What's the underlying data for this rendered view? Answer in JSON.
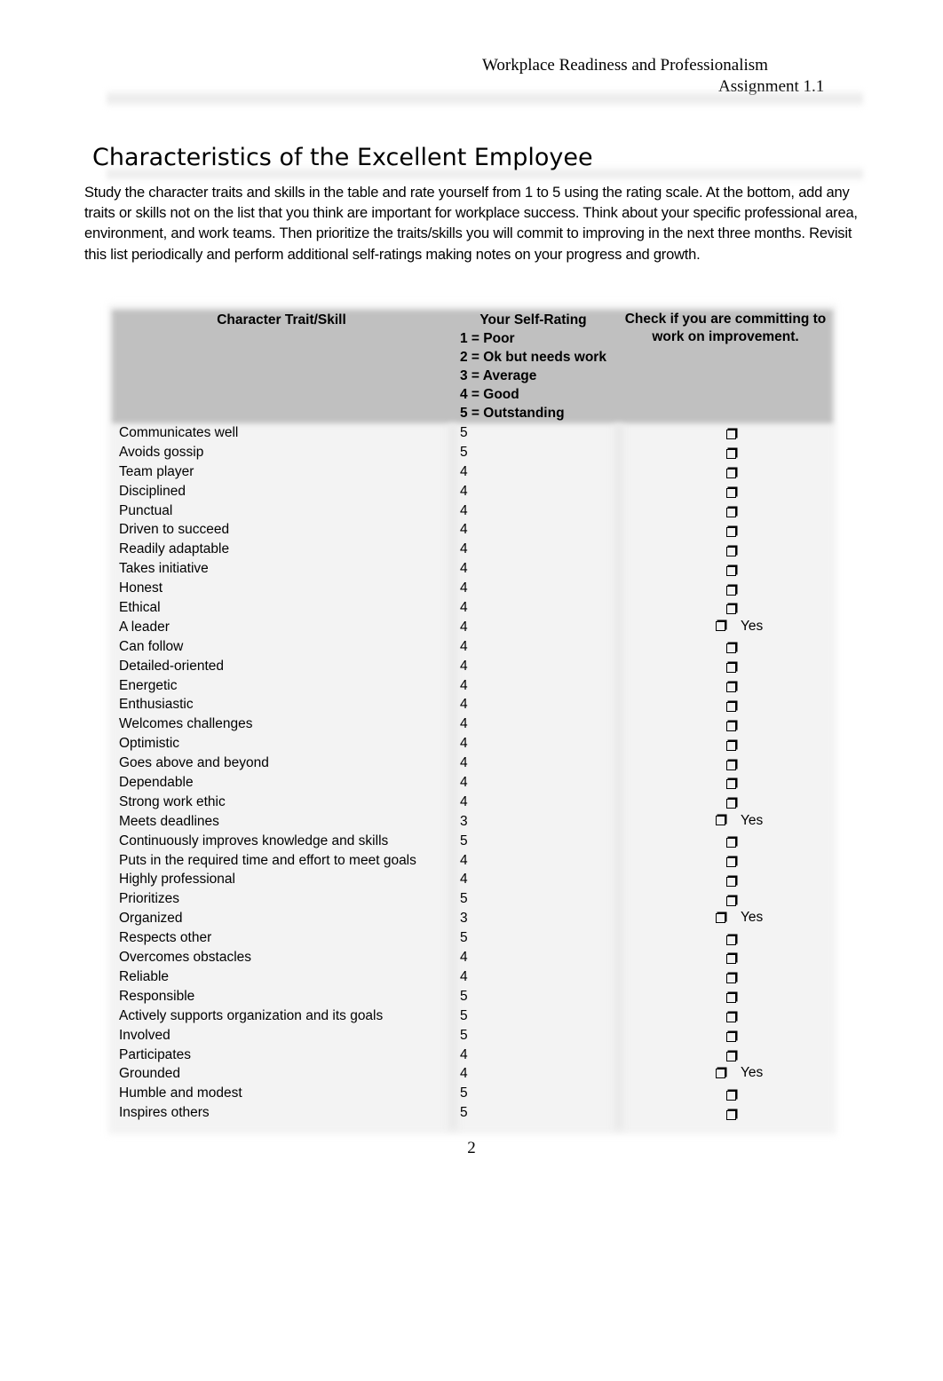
{
  "header": {
    "course": "Workplace Readiness and Professionalism",
    "assignment": "Assignment 1.1"
  },
  "title": "Characteristics of the Excellent Employee",
  "intro": "Study the character traits and skills in the table and rate yourself from 1 to 5 using the rating scale. At the bottom, add any traits or skills not on the list that you think are important for workplace success. Think about your specific professional area, environment, and work teams. Then prioritize the traits/skills you will commit to improving in the next three months. Revisit this list periodically and perform additional self-ratings making notes on your progress and growth.",
  "table": {
    "headers": {
      "trait": "Character Trait/Skill",
      "rating_title": "Your Self-Rating",
      "rating_scale": [
        "1 = Poor",
        "2 = Ok but needs work",
        "3 = Average",
        "4 = Good",
        "5 = Outstanding"
      ],
      "commit": "Check if you are committing to work on improvement."
    },
    "checkbox_icon": "shadowed-box",
    "rows": [
      {
        "trait": "Communicates well",
        "rating": "5",
        "commit": ""
      },
      {
        "trait": "Avoids gossip",
        "rating": "5",
        "commit": ""
      },
      {
        "trait": "Team player",
        "rating": "4",
        "commit": ""
      },
      {
        "trait": "Disciplined",
        "rating": "4",
        "commit": ""
      },
      {
        "trait": "Punctual",
        "rating": "4",
        "commit": ""
      },
      {
        "trait": "Driven to succeed",
        "rating": "4",
        "commit": ""
      },
      {
        "trait": "Readily adaptable",
        "rating": "4",
        "commit": ""
      },
      {
        "trait": "Takes initiative",
        "rating": "4",
        "commit": ""
      },
      {
        "trait": "Honest",
        "rating": "4",
        "commit": ""
      },
      {
        "trait": "Ethical",
        "rating": "4",
        "commit": ""
      },
      {
        "trait": "A leader",
        "rating": "4",
        "commit": "Yes"
      },
      {
        "trait": "Can follow",
        "rating": "4",
        "commit": ""
      },
      {
        "trait": "Detailed-oriented",
        "rating": "4",
        "commit": ""
      },
      {
        "trait": "Energetic",
        "rating": "4",
        "commit": ""
      },
      {
        "trait": "Enthusiastic",
        "rating": "4",
        "commit": ""
      },
      {
        "trait": "Welcomes challenges",
        "rating": "4",
        "commit": ""
      },
      {
        "trait": "Optimistic",
        "rating": "4",
        "commit": ""
      },
      {
        "trait": "Goes above and beyond",
        "rating": "4",
        "commit": ""
      },
      {
        "trait": "Dependable",
        "rating": "4",
        "commit": ""
      },
      {
        "trait": "Strong work ethic",
        "rating": "4",
        "commit": ""
      },
      {
        "trait": "Meets deadlines",
        "rating": "3",
        "commit": "Yes"
      },
      {
        "trait": "Continuously improves knowledge and skills",
        "rating": "5",
        "commit": ""
      },
      {
        "trait": "Puts in the required time and effort to meet goals",
        "rating": "4",
        "commit": ""
      },
      {
        "trait": "Highly professional",
        "rating": "4",
        "commit": ""
      },
      {
        "trait": "Prioritizes",
        "rating": "5",
        "commit": ""
      },
      {
        "trait": "Organized",
        "rating": "3",
        "commit": "Yes"
      },
      {
        "trait": "Respects other",
        "rating": "5",
        "commit": ""
      },
      {
        "trait": "Overcomes obstacles",
        "rating": "4",
        "commit": ""
      },
      {
        "trait": "Reliable",
        "rating": "4",
        "commit": ""
      },
      {
        "trait": "Responsible",
        "rating": "5",
        "commit": ""
      },
      {
        "trait": "Actively supports organization and its goals",
        "rating": "5",
        "commit": ""
      },
      {
        "trait": "Involved",
        "rating": "5",
        "commit": ""
      },
      {
        "trait": "Participates",
        "rating": "4",
        "commit": ""
      },
      {
        "trait": "Grounded",
        "rating": "4",
        "commit": "Yes"
      },
      {
        "trait": "Humble and modest",
        "rating": "5",
        "commit": ""
      },
      {
        "trait": "Inspires others",
        "rating": "5",
        "commit": ""
      }
    ]
  },
  "page_number": "2"
}
